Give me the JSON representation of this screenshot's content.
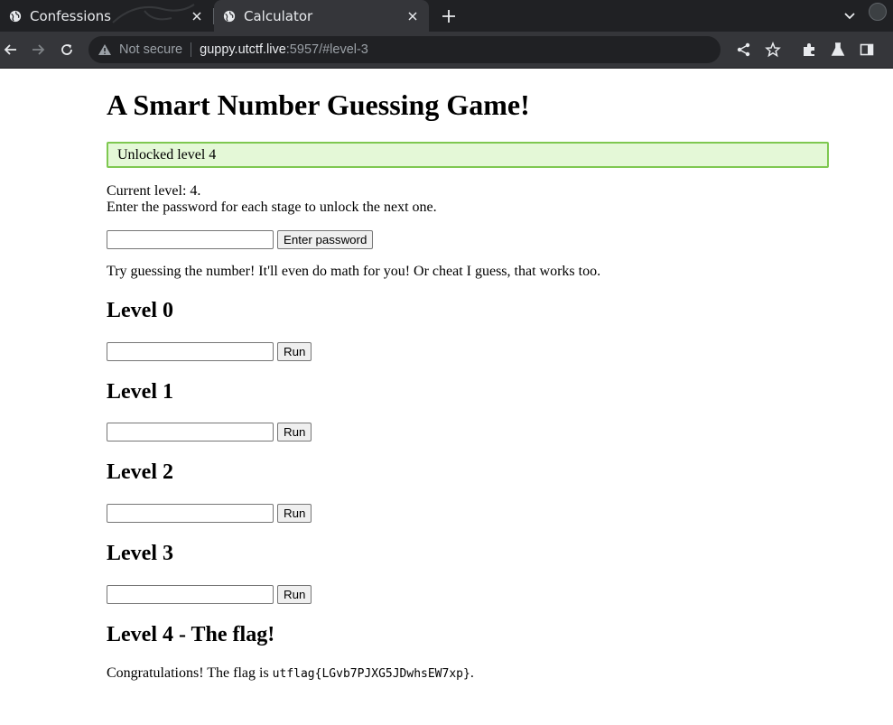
{
  "browser": {
    "tabs": [
      {
        "title": "Confessions",
        "active": false
      },
      {
        "title": "Calculator",
        "active": true
      }
    ],
    "address": {
      "security": "Not secure",
      "host": "guppy.utctf.live",
      "rest": ":5957/#level-3"
    }
  },
  "page": {
    "title": "A Smart Number Guessing Game!",
    "alert": "Unlocked level 4",
    "current_level_line": "Current level: 4.",
    "instruction": "Enter the password for each stage to unlock the next one.",
    "password_input": {
      "value": "",
      "placeholder": ""
    },
    "password_button": "Enter password",
    "tip": "Try guessing the number! It'll even do math for you! Or cheat I guess, that works too.",
    "levels": [
      {
        "heading": "Level 0",
        "input_value": "",
        "button": "Run"
      },
      {
        "heading": "Level 1",
        "input_value": "",
        "button": "Run"
      },
      {
        "heading": "Level 2",
        "input_value": "",
        "button": "Run"
      },
      {
        "heading": "Level 3",
        "input_value": "",
        "button": "Run"
      }
    ],
    "flag_heading": "Level 4 - The flag!",
    "congrats_prefix": "Congratulations! The flag is ",
    "flag": "utflag{LGvb7PJXG5JDwhsEW7xp}",
    "congrats_suffix": "."
  },
  "colors": {
    "tabstrip_bg": "#202124",
    "toolbar_bg": "#35363a",
    "alert_bg": "#e4f8d7",
    "alert_border": "#7ec850"
  },
  "icons": {
    "tab": "globe-icon",
    "close": "close-icon",
    "new_tab": "plus-icon",
    "back": "back-arrow-icon",
    "forward": "forward-arrow-icon",
    "reload": "reload-icon",
    "security": "warning-triangle-icon",
    "share": "share-icon",
    "bookmark": "star-icon",
    "extensions": "puzzle-icon",
    "labs": "flask-icon",
    "side_panel": "side-panel-icon"
  }
}
